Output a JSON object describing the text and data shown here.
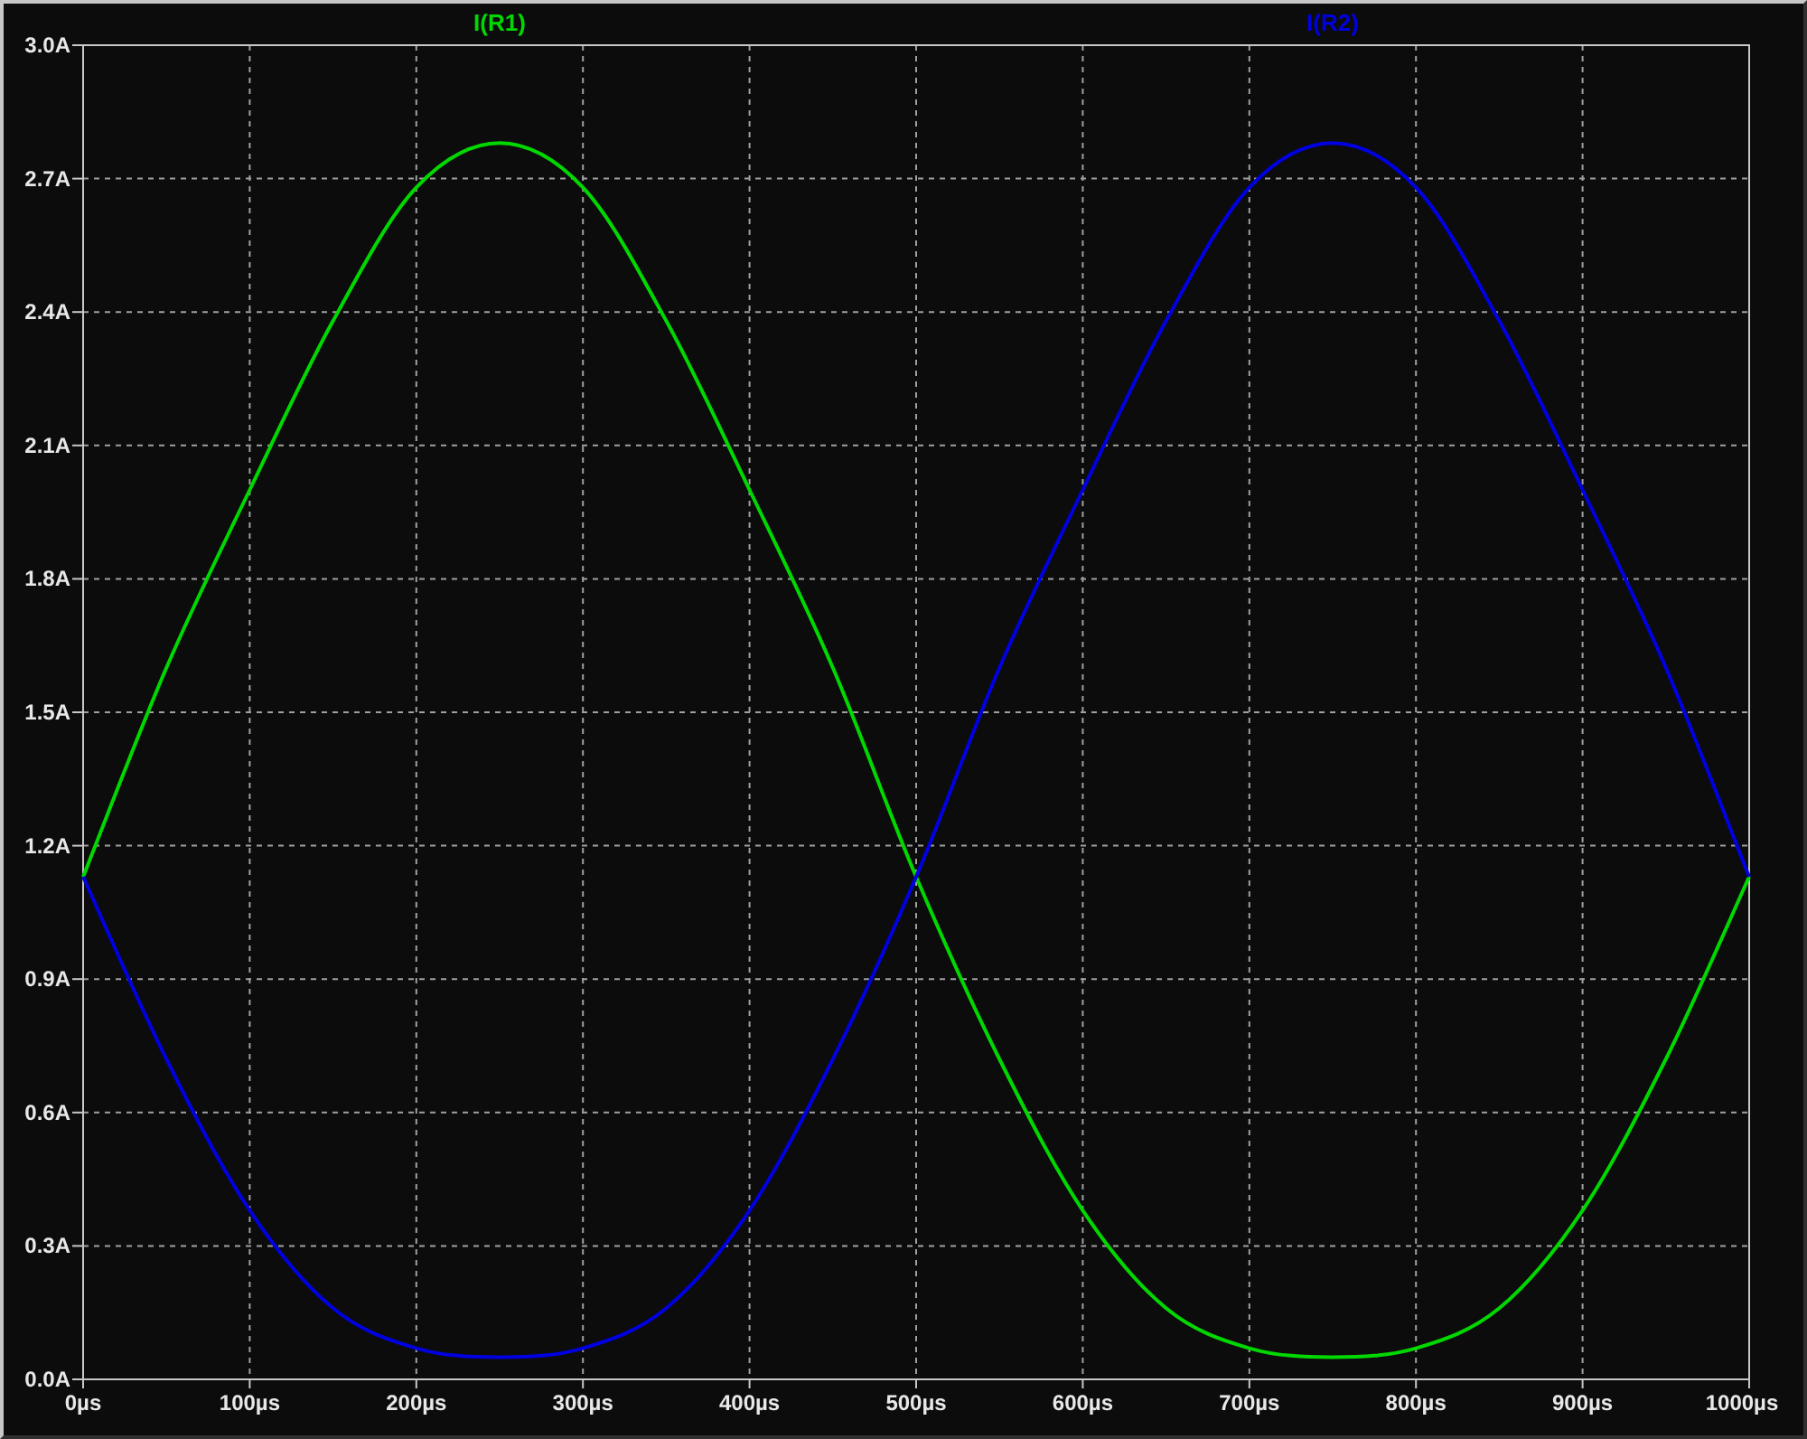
{
  "chart_data": {
    "type": "line",
    "grid": true,
    "x": [
      0,
      50,
      100,
      150,
      200,
      250,
      300,
      350,
      400,
      450,
      500,
      550,
      600,
      650,
      700,
      750,
      800,
      850,
      900,
      950,
      1000
    ],
    "series": [
      {
        "name": "I(R1)",
        "color": "#00d800",
        "values": [
          1.13,
          1.6,
          2.0,
          2.38,
          2.68,
          2.78,
          2.68,
          2.38,
          2.0,
          1.6,
          1.13,
          0.72,
          0.38,
          0.16,
          0.07,
          0.05,
          0.07,
          0.16,
          0.38,
          0.72,
          1.13
        ]
      },
      {
        "name": "I(R2)",
        "color": "#0000e0",
        "values": [
          1.13,
          0.72,
          0.38,
          0.16,
          0.07,
          0.05,
          0.07,
          0.16,
          0.38,
          0.72,
          1.13,
          1.6,
          2.0,
          2.38,
          2.68,
          2.78,
          2.68,
          2.38,
          2.0,
          1.6,
          1.13
        ]
      }
    ],
    "xlim": [
      0,
      1000
    ],
    "ylim": [
      0,
      3
    ],
    "xticks": [
      {
        "value": 0,
        "label": "0µs"
      },
      {
        "value": 100,
        "label": "100µs"
      },
      {
        "value": 200,
        "label": "200µs"
      },
      {
        "value": 300,
        "label": "300µs"
      },
      {
        "value": 400,
        "label": "400µs"
      },
      {
        "value": 500,
        "label": "500µs"
      },
      {
        "value": 600,
        "label": "600µs"
      },
      {
        "value": 700,
        "label": "700µs"
      },
      {
        "value": 800,
        "label": "800µs"
      },
      {
        "value": 900,
        "label": "900µs"
      },
      {
        "value": 1000,
        "label": "1000µs"
      }
    ],
    "yticks": [
      {
        "value": 0,
        "label": "0.0A"
      },
      {
        "value": 0.3,
        "label": "0.3A"
      },
      {
        "value": 0.6,
        "label": "0.6A"
      },
      {
        "value": 0.9,
        "label": "0.9A"
      },
      {
        "value": 1.2,
        "label": "1.2A"
      },
      {
        "value": 1.5,
        "label": "1.5A"
      },
      {
        "value": 1.8,
        "label": "1.8A"
      },
      {
        "value": 2.1,
        "label": "2.1A"
      },
      {
        "value": 2.4,
        "label": "2.4A"
      },
      {
        "value": 2.7,
        "label": "2.7A"
      },
      {
        "value": 3.0,
        "label": "3.0A"
      }
    ]
  }
}
